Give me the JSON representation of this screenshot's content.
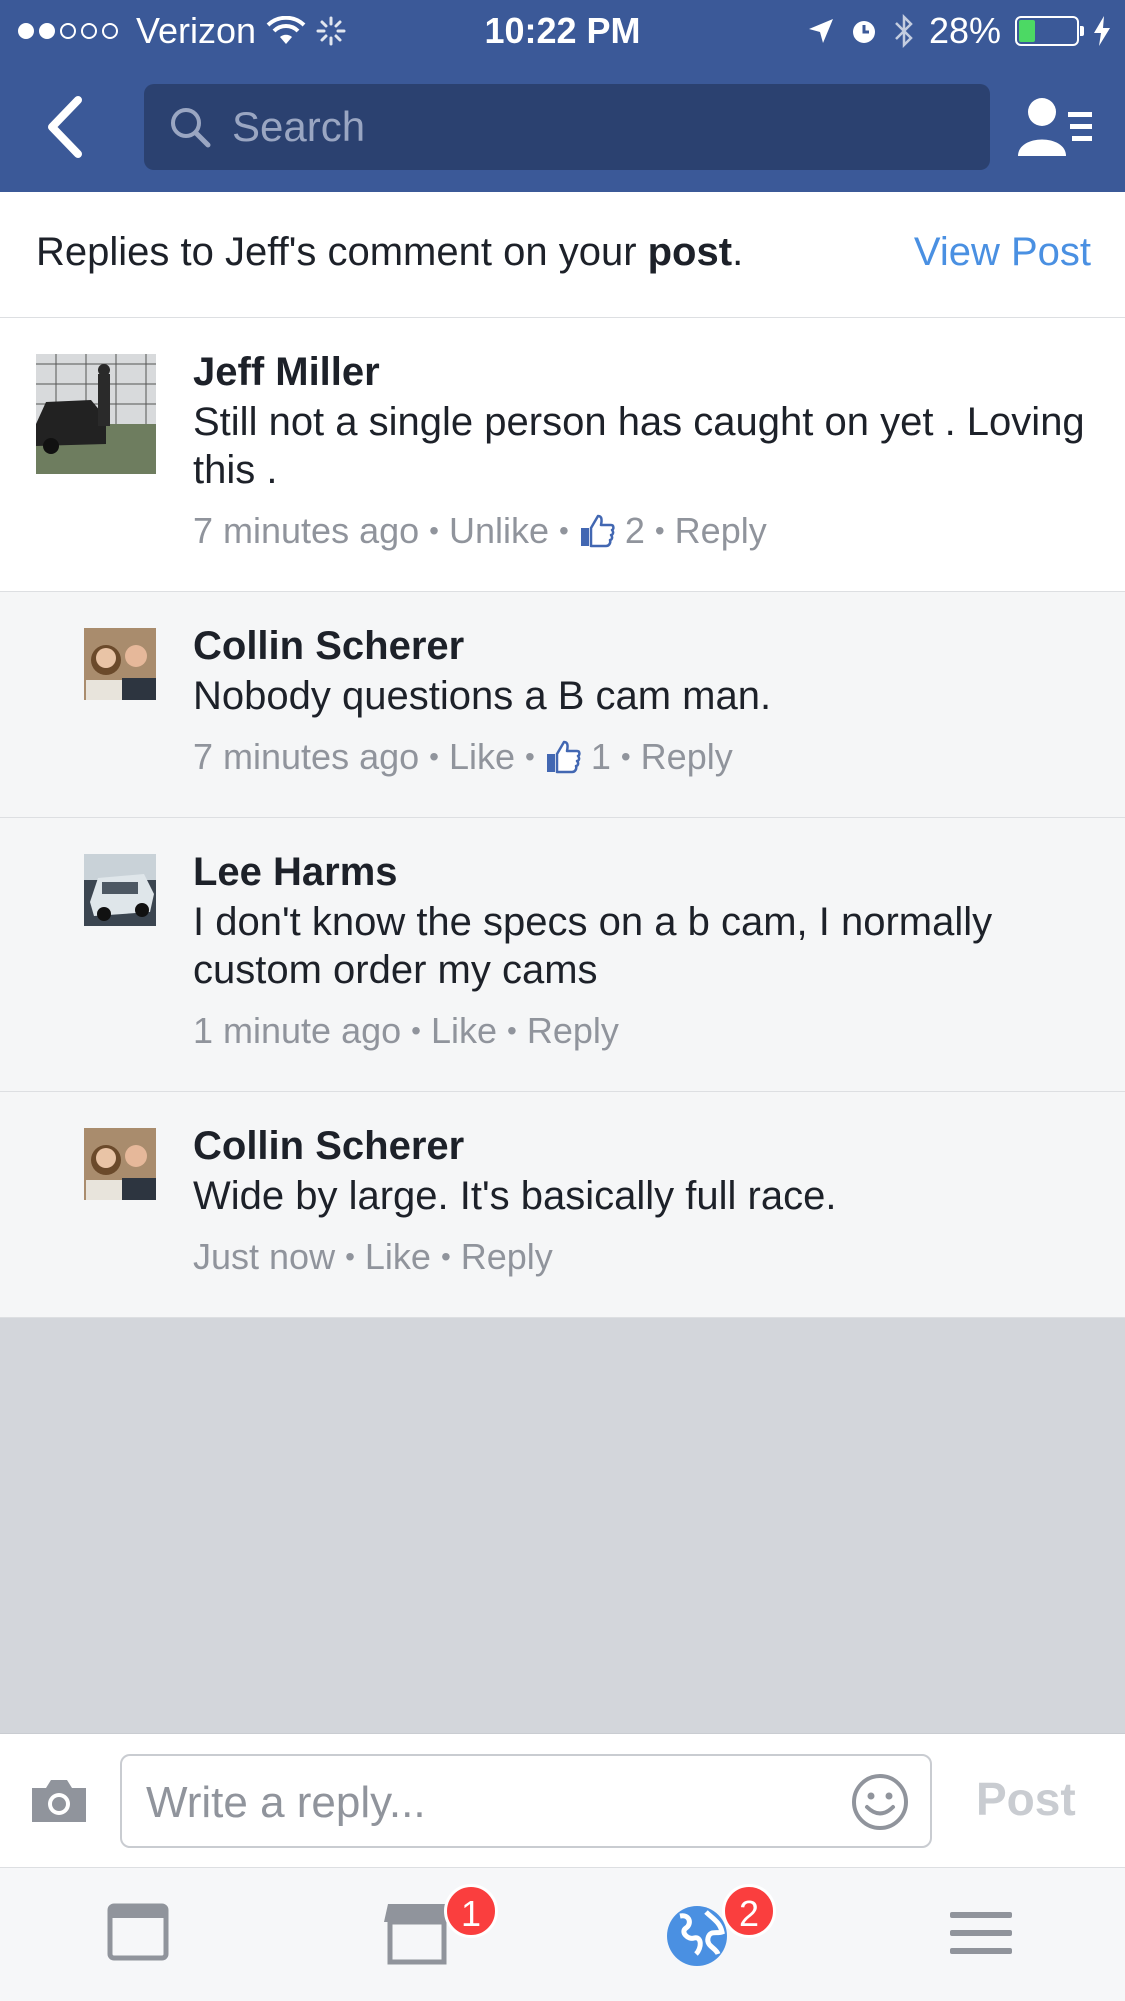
{
  "status_bar": {
    "carrier": "Verizon",
    "time": "10:22 PM",
    "battery": "28%",
    "battery_level": 0.28
  },
  "nav": {
    "search_placeholder": "Search"
  },
  "header": {
    "text_prefix": "Replies to Jeff's comment on your ",
    "text_bold": "post",
    "text_suffix": ".",
    "view_post": "View Post"
  },
  "comments": [
    {
      "name": "Jeff Miller",
      "text": "Still not a single person has caught on yet . Loving this .",
      "time": "7 minutes ago",
      "action": "Unlike",
      "likes": "2",
      "reply": "Reply"
    },
    {
      "name": "Collin Scherer",
      "text": "Nobody questions a B cam man.",
      "time": "7 minutes ago",
      "action": "Like",
      "likes": "1",
      "reply": "Reply"
    },
    {
      "name": "Lee Harms",
      "text": "I don't know  the specs on a b cam, I normally custom order my cams",
      "time": "1 minute ago",
      "action": "Like",
      "reply": "Reply"
    },
    {
      "name": "Collin Scherer",
      "text": "Wide by large. It's basically full race.",
      "time": "Just now",
      "action": "Like",
      "reply": "Reply"
    }
  ],
  "composer": {
    "placeholder": "Write a reply...",
    "post_label": "Post"
  },
  "tabbar": {
    "marketplace_badge": "1",
    "notifications_badge": "2"
  },
  "colors": {
    "brand": "#3b5998",
    "link": "#4a90e2",
    "badge": "#fa3e3e",
    "like_blue": "#4267b2"
  }
}
